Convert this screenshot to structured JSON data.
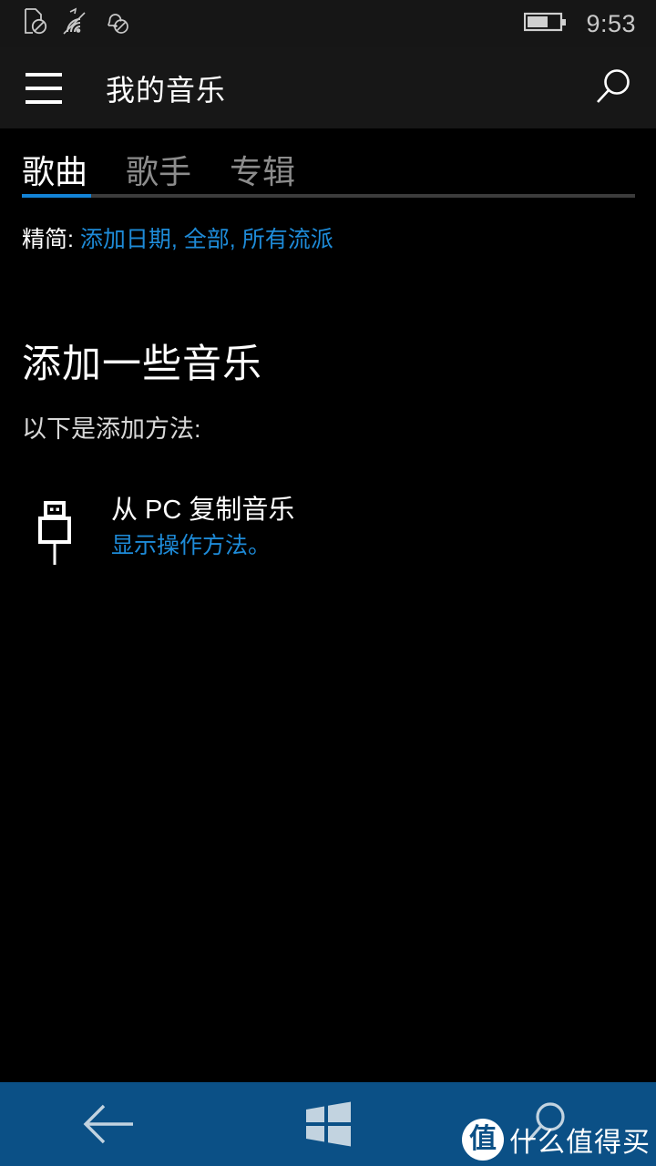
{
  "status_bar": {
    "icons": [
      "sim-disabled-icon",
      "wifi-arrow-icon",
      "notifications-off-icon"
    ],
    "battery": {
      "level_percent": 60,
      "name": "battery-icon"
    },
    "time": "9:53"
  },
  "app_bar": {
    "menu_label": "menu",
    "title": "我的音乐",
    "search_label": "search"
  },
  "tabs": [
    {
      "label": "歌曲",
      "active": true
    },
    {
      "label": "歌手",
      "active": false
    },
    {
      "label": "专辑",
      "active": false
    }
  ],
  "filter": {
    "label": "精简:",
    "links": "添加日期, 全部, 所有流派",
    "options": [
      "添加日期",
      "全部",
      "所有流派"
    ]
  },
  "empty_state": {
    "title": "添加一些音乐",
    "subtitle": "以下是添加方法:",
    "methods": [
      {
        "icon": "usb-icon",
        "title": "从 PC 复制音乐",
        "link": "显示操作方法。"
      }
    ]
  },
  "nav_bar": {
    "back_label": "back",
    "home_label": "start",
    "search_label": "search"
  },
  "watermark": {
    "logo_char": "值",
    "text": "什么值得买"
  },
  "colors": {
    "accent_blue": "#1e8bd8",
    "tab_underline": "#1383d6",
    "nav_bar_blue": "#0b5086",
    "background": "#000000",
    "app_bar": "#171717",
    "status_bar": "#161616"
  }
}
